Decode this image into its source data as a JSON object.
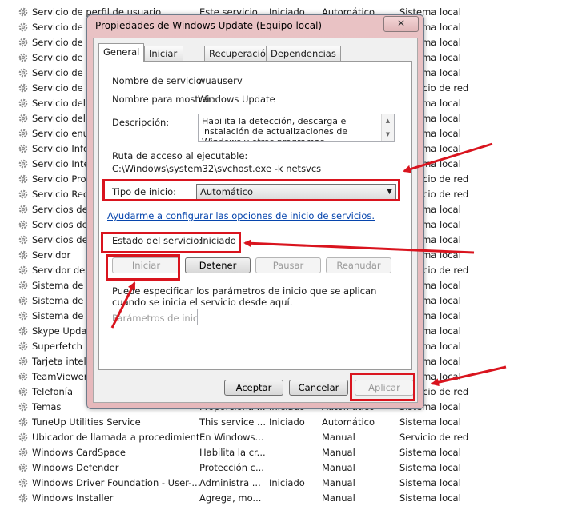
{
  "services": [
    {
      "name": "Servicio de perfil de usuario",
      "desc": "Este servicio ...",
      "status": "Iniciado",
      "start": "Automático",
      "logon": "Sistema local"
    },
    {
      "name": "Servicio de p",
      "desc": "",
      "status": "",
      "start": "",
      "logon": "Sistema local"
    },
    {
      "name": "Servicio de p",
      "desc": "",
      "status": "",
      "start": "",
      "logon": "Sistema local"
    },
    {
      "name": "Servicio de p",
      "desc": "",
      "status": "",
      "start": "",
      "logon": "Sistema local"
    },
    {
      "name": "Servicio de p",
      "desc": "",
      "status": "",
      "start": "",
      "logon": "Sistema local"
    },
    {
      "name": "Servicio de u",
      "desc": "",
      "status": "",
      "start": "",
      "logon": "Servicio de red"
    },
    {
      "name": "Servicio del ir",
      "desc": "",
      "status": "",
      "start": "",
      "logon": "Sistema local"
    },
    {
      "name": "Servicio del n",
      "desc": "",
      "status": "",
      "start": "",
      "logon": "Sistema local"
    },
    {
      "name": "Servicio enur",
      "desc": "",
      "status": "",
      "start": "",
      "logon": "Sistema local"
    },
    {
      "name": "Servicio Infor",
      "desc": "",
      "status": "",
      "start": "",
      "logon": "Sistema local"
    },
    {
      "name": "Servicio Inter",
      "desc": "",
      "status": "",
      "start": "",
      "logon": "Sistema local"
    },
    {
      "name": "Servicio Prog",
      "desc": "",
      "status": "",
      "start": "",
      "logon": "Servicio de red"
    },
    {
      "name": "Servicio Rece",
      "desc": "",
      "status": "",
      "start": "",
      "logon": "Servicio de red"
    },
    {
      "name": "Servicios de b",
      "desc": "",
      "status": "",
      "start": "",
      "logon": "Sistema local"
    },
    {
      "name": "Servicios de c",
      "desc": "",
      "status": "",
      "start": "",
      "logon": "Sistema local"
    },
    {
      "name": "Servicios de E",
      "desc": "",
      "status": "",
      "start": "",
      "logon": "Sistema local"
    },
    {
      "name": "Servidor",
      "desc": "",
      "status": "",
      "start": "",
      "logon": "Sistema local"
    },
    {
      "name": "Servidor de o",
      "desc": "",
      "status": "",
      "start": "",
      "logon": "Servicio de red"
    },
    {
      "name": "Sistema de ci",
      "desc": "",
      "status": "",
      "start": "",
      "logon": "Sistema local"
    },
    {
      "name": "Sistema de co",
      "desc": "",
      "status": "",
      "start": "",
      "logon": "Sistema local"
    },
    {
      "name": "Sistema de ev",
      "desc": "",
      "status": "",
      "start": "",
      "logon": "Sistema local"
    },
    {
      "name": "Skype Update",
      "desc": "",
      "status": "",
      "start": "",
      "logon": "Sistema local"
    },
    {
      "name": "Superfetch",
      "desc": "",
      "status": "",
      "start": "",
      "logon": "Sistema local"
    },
    {
      "name": "Tarjeta intelig",
      "desc": "",
      "status": "",
      "start": "",
      "logon": "Sistema local"
    },
    {
      "name": "TeamViewer",
      "desc": "",
      "status": "",
      "start": "",
      "logon": "Sistema local"
    },
    {
      "name": "Telefonía",
      "desc": "",
      "status": "",
      "start": "",
      "logon": "Servicio de red"
    },
    {
      "name": "Temas",
      "desc": "Proporciona ...",
      "status": "Iniciado",
      "start": "Automático",
      "logon": "Sistema local"
    },
    {
      "name": "TuneUp Utilities Service",
      "desc": "This service ...",
      "status": "Iniciado",
      "start": "Automático",
      "logon": "Sistema local"
    },
    {
      "name": "Ubicador de llamada a procedimient...",
      "desc": "En Windows...",
      "status": "",
      "start": "Manual",
      "logon": "Servicio de red"
    },
    {
      "name": "Windows CardSpace",
      "desc": "Habilita la cr...",
      "status": "",
      "start": "Manual",
      "logon": "Sistema local"
    },
    {
      "name": "Windows Defender",
      "desc": "Protección c...",
      "status": "",
      "start": "Manual",
      "logon": "Sistema local"
    },
    {
      "name": "Windows Driver Foundation - User-...",
      "desc": "Administra ...",
      "status": "Iniciado",
      "start": "Manual",
      "logon": "Sistema local"
    },
    {
      "name": "Windows Installer",
      "desc": "Agrega, mo...",
      "status": "",
      "start": "Manual",
      "logon": "Sistema local"
    }
  ],
  "dialog": {
    "title": "Propiedades de Windows Update (Equipo local)",
    "close_label": "✕",
    "tabs": [
      "General",
      "Iniciar sesión",
      "Recuperación",
      "Dependencias"
    ],
    "service_name_label": "Nombre de servicio:",
    "service_name_value": "wuauserv",
    "display_name_label": "Nombre para mostrar:",
    "display_name_value": "Windows Update",
    "description_label": "Descripción:",
    "description_value": "Habilita la detección, descarga e instalación de actualizaciones de Windows y otros programas.",
    "path_label": "Ruta de acceso al ejecutable:",
    "path_value": "C:\\Windows\\system32\\svchost.exe -k netsvcs",
    "startup_type_label": "Tipo de inicio:",
    "startup_type_value": "Automático",
    "help_link": "Ayudarme a configurar las opciones de inicio de servicios.",
    "status_label": "Estado del servicio:",
    "status_value": "Iniciado",
    "btn_start": "Iniciar",
    "btn_stop": "Detener",
    "btn_pause": "Pausar",
    "btn_resume": "Reanudar",
    "params_hint": "Puede especificar los parámetros de inicio que se aplican cuando se inicia el servicio desde aquí.",
    "params_label": "Parámetros de inicio:",
    "params_value": "",
    "btn_ok": "Aceptar",
    "btn_cancel": "Cancelar",
    "btn_apply": "Aplicar"
  },
  "colors": {
    "highlight": "#d9141e",
    "link": "#0645ad"
  }
}
